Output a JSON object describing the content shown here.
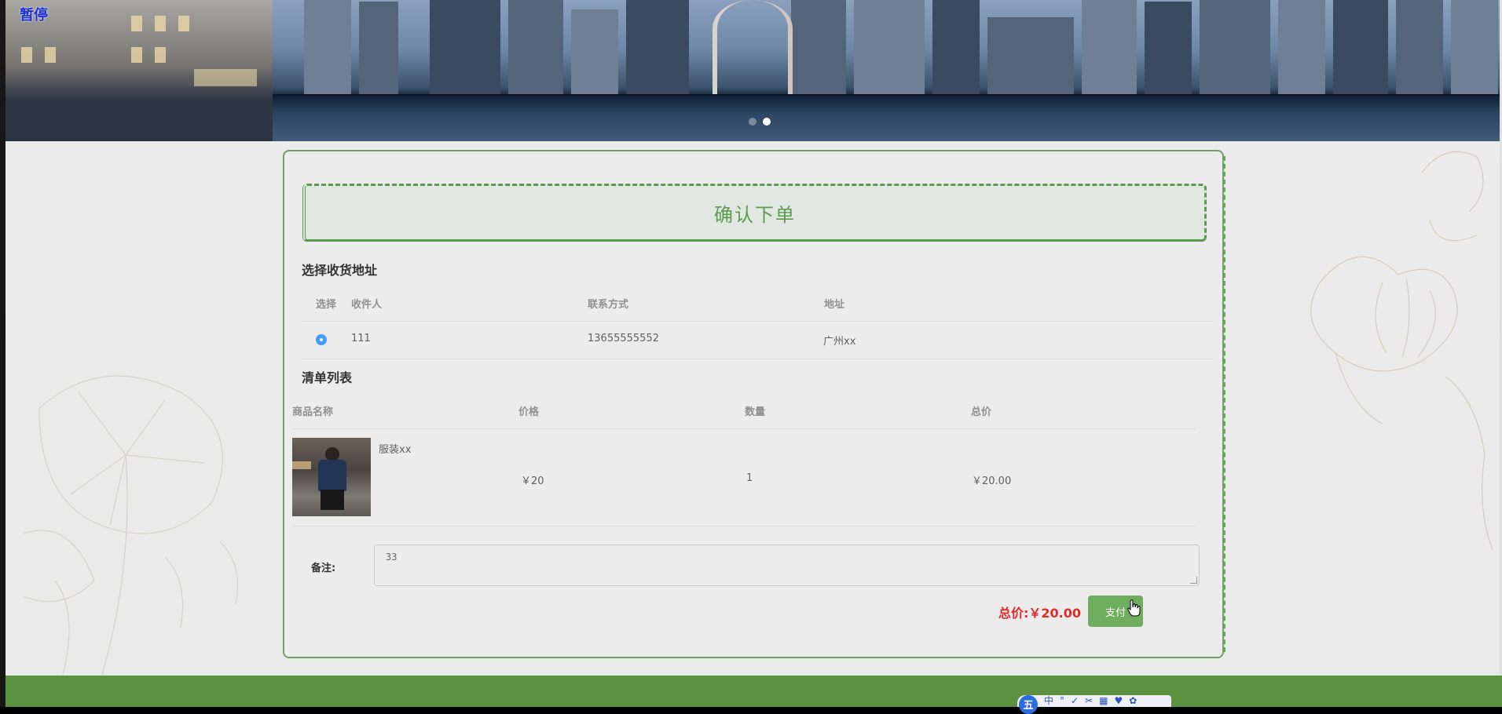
{
  "banner": {
    "pause_label": "暂停",
    "dots_total": 2,
    "dots_active_index": 1
  },
  "order": {
    "title": "确认下单",
    "address_section": {
      "title": "选择收货地址",
      "headers": [
        "选择",
        "收件人",
        "联系方式",
        "地址"
      ],
      "rows": [
        {
          "selected": true,
          "recipient": "111",
          "phone": "13655555552",
          "address": "广州xx"
        }
      ]
    },
    "list_section": {
      "title": "清单列表",
      "headers": [
        "商品名称",
        "价格",
        "数量",
        "总价"
      ],
      "rows": [
        {
          "name": "服装xx",
          "price": "￥20",
          "quantity": "1",
          "total": "￥20.00"
        }
      ]
    },
    "note_label": "备注:",
    "note_value": "33",
    "total_label": "总价:￥20.00",
    "pay_button": "支付"
  },
  "taskbar": {
    "ime_logo": "五",
    "ime_items": [
      "中",
      "°",
      "✓",
      "✂",
      "▦",
      "♥",
      "✿"
    ]
  },
  "colors": {
    "accent_green": "#5b9a4f",
    "pay_button": "#6fae5f",
    "total_red": "#e02b2b",
    "radio_blue": "#409eff",
    "footer": "#5c9140"
  }
}
